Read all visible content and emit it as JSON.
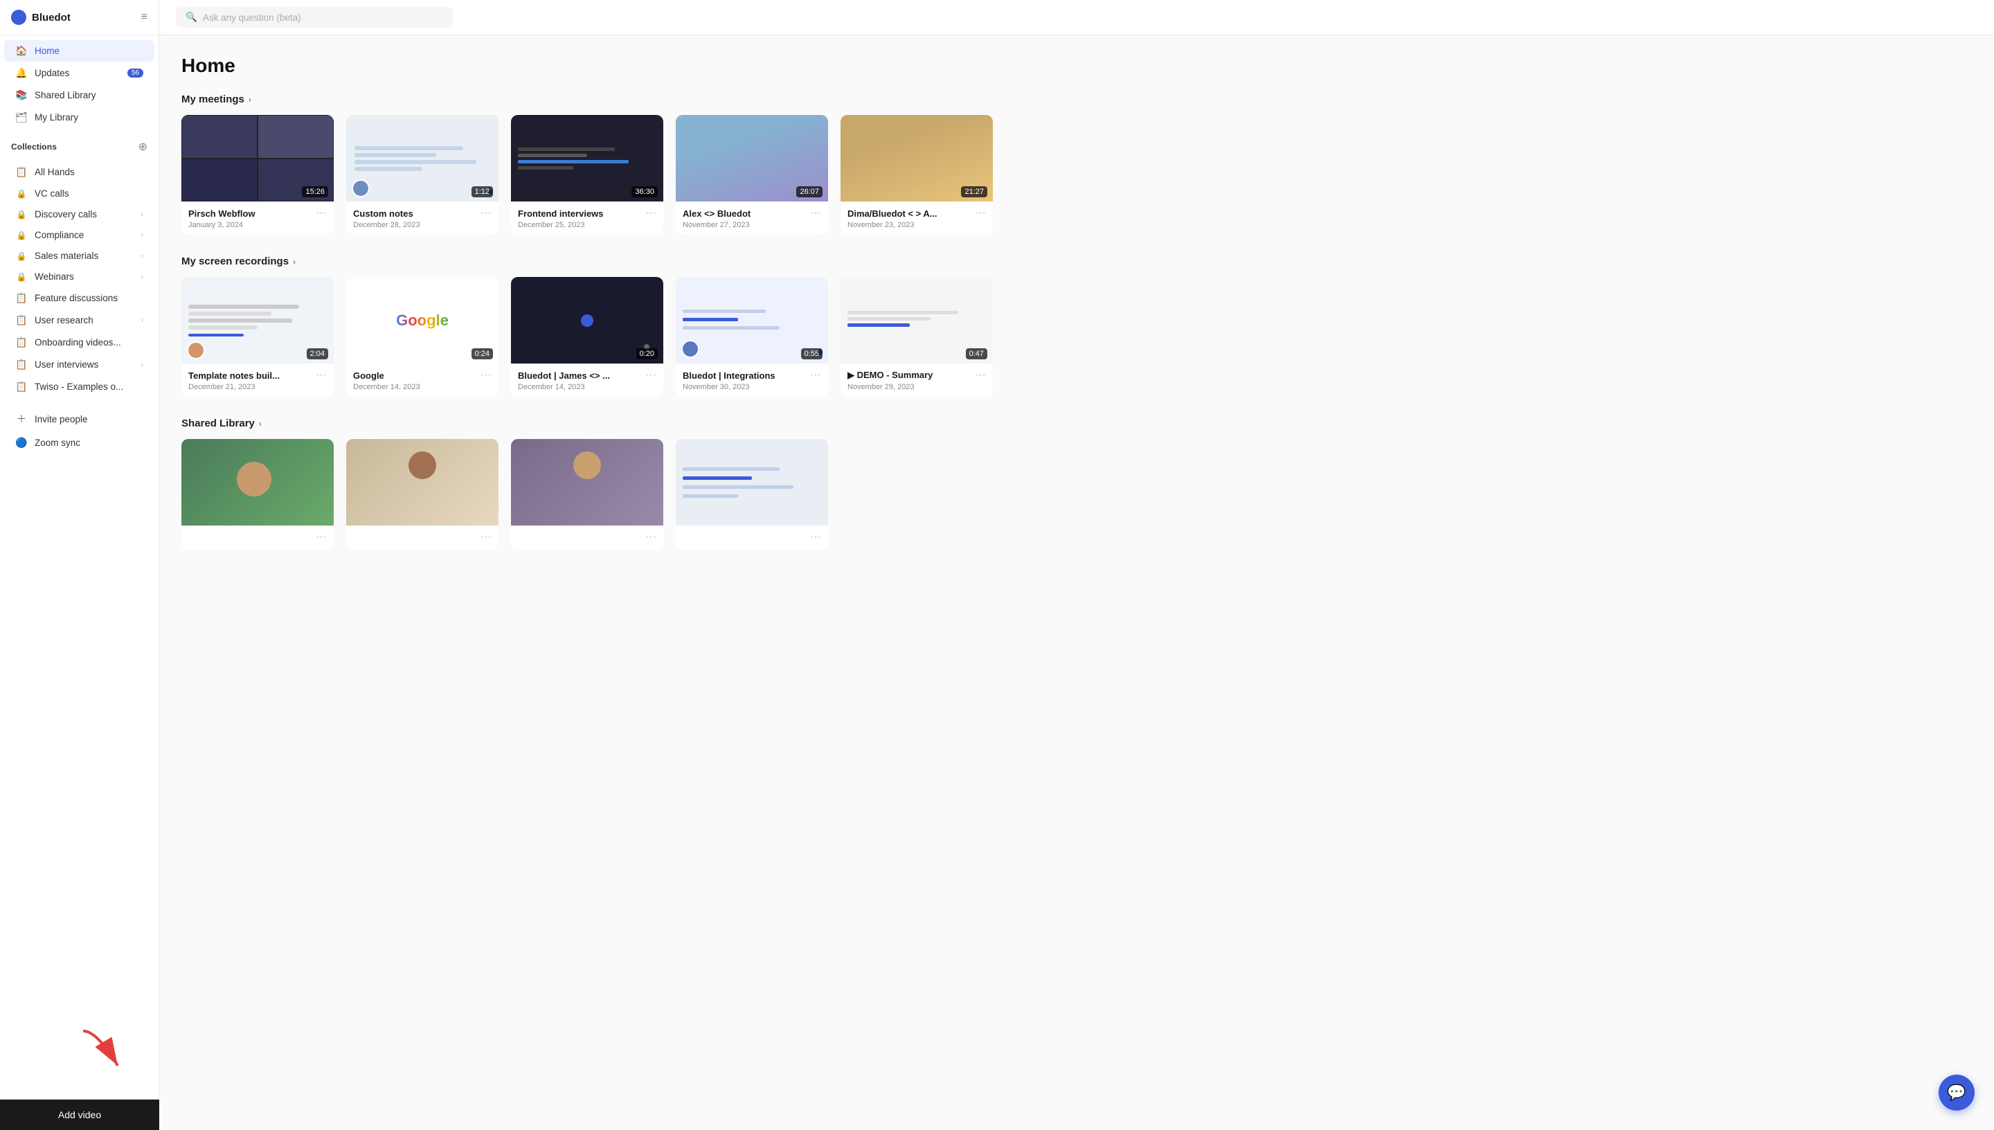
{
  "app": {
    "brand": "Bluedot",
    "hamburger": "≡"
  },
  "sidebar": {
    "nav": [
      {
        "id": "home",
        "icon": "🏠",
        "label": "Home",
        "active": true
      },
      {
        "id": "updates",
        "icon": "🔔",
        "label": "Updates",
        "badge": "56"
      },
      {
        "id": "shared-library",
        "icon": "📚",
        "label": "Shared Library"
      },
      {
        "id": "my-library",
        "icon": "🗂",
        "label": "My Library"
      }
    ],
    "collections_title": "Collections",
    "collections": [
      {
        "id": "all-hands",
        "icon": "📋",
        "label": "All Hands",
        "locked": false
      },
      {
        "id": "vc-calls",
        "icon": "🔒",
        "label": "VC calls",
        "locked": true
      },
      {
        "id": "discovery-calls",
        "icon": "🔒",
        "label": "Discovery calls",
        "locked": true,
        "has_arrow": true
      },
      {
        "id": "compliance",
        "icon": "🔒",
        "label": "Compliance",
        "locked": true,
        "has_arrow": true
      },
      {
        "id": "sales-materials",
        "icon": "🔒",
        "label": "Sales materials",
        "locked": true,
        "has_arrow": true
      },
      {
        "id": "webinars",
        "icon": "🔒",
        "label": "Webinars",
        "locked": true,
        "has_arrow": true
      },
      {
        "id": "feature-discussions",
        "icon": "📋",
        "label": "Feature discussions",
        "locked": false
      },
      {
        "id": "user-research",
        "icon": "📋",
        "label": "User research",
        "locked": false,
        "has_arrow": true
      },
      {
        "id": "onboarding-videos",
        "icon": "📋",
        "label": "Onboarding videos...",
        "locked": false
      },
      {
        "id": "user-interviews",
        "icon": "📋",
        "label": "User interviews",
        "locked": false,
        "has_arrow": true
      },
      {
        "id": "twiso-examples",
        "icon": "📋",
        "label": "Twiso - Examples o...",
        "locked": false
      }
    ],
    "invite_people": "Invite people",
    "zoom_sync": "Zoom sync",
    "add_video_label": "Add video"
  },
  "topbar": {
    "search_placeholder": "Ask any question (beta)"
  },
  "main": {
    "page_title": "Home",
    "sections": [
      {
        "id": "my-meetings",
        "label": "My meetings",
        "cards": [
          {
            "id": "pirsch-webflow",
            "title": "Pirsch Webflow",
            "date": "January 3, 2024",
            "duration": "15:26",
            "thumb": "meeting",
            "has_avatar": false
          },
          {
            "id": "custom-notes",
            "title": "Custom notes",
            "date": "December 28, 2023",
            "duration": "1:12",
            "thumb": "notes",
            "has_avatar": true,
            "has_sync": true
          },
          {
            "id": "frontend-interviews",
            "title": "Frontend interviews",
            "date": "December 25, 2023",
            "duration": "36:30",
            "thumb": "code"
          },
          {
            "id": "alex-bluedot",
            "title": "Alex <> Bluedot",
            "date": "November 27, 2023",
            "duration": "26:07",
            "thumb": "mountain"
          },
          {
            "id": "dima-bluedot",
            "title": "Dima/Bluedot < > A...",
            "date": "November 23, 2023",
            "duration": "21:27",
            "thumb": "mountain2"
          }
        ]
      },
      {
        "id": "my-screen-recordings",
        "label": "My screen recordings",
        "cards": [
          {
            "id": "template-notes",
            "title": "Template notes buil...",
            "date": "December 21, 2023",
            "duration": "2:04",
            "thumb": "screen",
            "has_avatar": true
          },
          {
            "id": "google",
            "title": "Google",
            "date": "December 14, 2023",
            "duration": "0:24",
            "thumb": "google"
          },
          {
            "id": "bluedot-james",
            "title": "Bluedot | James <> ...",
            "date": "December 14, 2023",
            "duration": "0:20",
            "thumb": "bluedot-dark"
          },
          {
            "id": "bluedot-integrations",
            "title": "Bluedot | Integrations",
            "date": "November 30, 2023",
            "duration": "0:55",
            "thumb": "integrations",
            "has_avatar": true,
            "has_sync": true
          },
          {
            "id": "demo-summary",
            "title": "▶ DEMO - Summary",
            "date": "November 29, 2023",
            "duration": "0:47",
            "thumb": "demo"
          }
        ]
      },
      {
        "id": "shared-library",
        "label": "Shared Library",
        "cards": [
          {
            "id": "shared-1",
            "title": "",
            "date": "",
            "duration": "",
            "thumb": "shared1"
          },
          {
            "id": "shared-2",
            "title": "",
            "date": "",
            "duration": "",
            "thumb": "shared2"
          },
          {
            "id": "shared-3",
            "title": "",
            "date": "",
            "duration": "",
            "thumb": "shared3"
          },
          {
            "id": "shared-4",
            "title": "",
            "date": "",
            "duration": "",
            "thumb": "shared4"
          }
        ]
      }
    ]
  },
  "colors": {
    "accent": "#3b5bdb",
    "bg": "#fafafa"
  }
}
